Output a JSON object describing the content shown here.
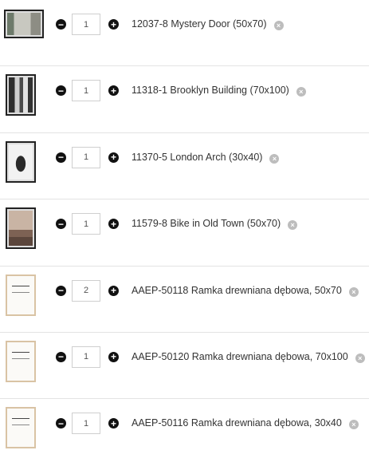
{
  "cart": {
    "items": [
      {
        "name": "12037-8 Mystery Door (50x70)",
        "qty": "1",
        "thumb": "wide",
        "colors": [
          "#6d7a6a",
          "#c8c8c0"
        ]
      },
      {
        "name": "11318-1 Brooklyn Building (70x100)",
        "qty": "1",
        "thumb": "photo",
        "colors": [
          "#3a3a3a",
          "#cfcfcf"
        ]
      },
      {
        "name": "11370-5 London Arch (30x40)",
        "qty": "1",
        "thumb": "photo",
        "colors": [
          "#f0f0f0",
          "#2a2a2a"
        ]
      },
      {
        "name": "11579-8 Bike in Old Town (50x70)",
        "qty": "1",
        "thumb": "photo",
        "colors": [
          "#b89a86",
          "#6b5246"
        ]
      },
      {
        "name": "AAEP-50118 Ramka drewniana dębowa, 50x70",
        "qty": "2",
        "thumb": "frame",
        "colors": [
          "#fbfaf7",
          "#d9c3a4"
        ]
      },
      {
        "name": "AAEP-50120 Ramka drewniana dębowa, 70x100",
        "qty": "1",
        "thumb": "frame",
        "colors": [
          "#fbfaf7",
          "#d9c3a4"
        ]
      },
      {
        "name": "AAEP-50116 Ramka drewniana dębowa, 30x40",
        "qty": "1",
        "thumb": "frame",
        "colors": [
          "#fbfaf7",
          "#d9c3a4"
        ]
      }
    ],
    "icons": {
      "minus": "minus-circle-icon",
      "plus": "plus-circle-icon",
      "remove": "remove-x-icon"
    }
  }
}
